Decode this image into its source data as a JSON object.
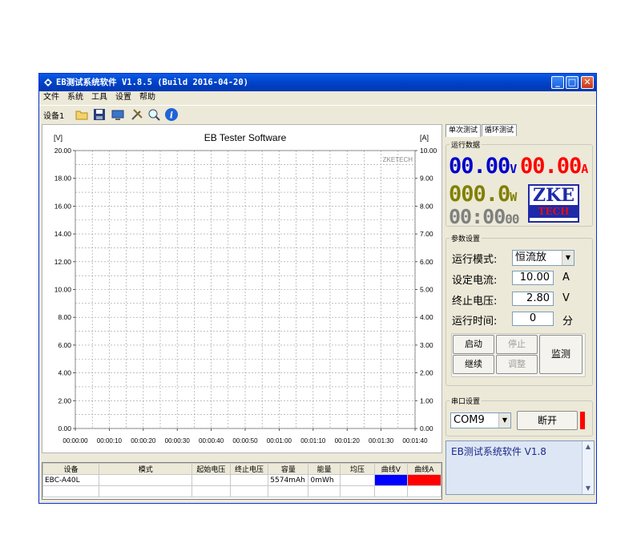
{
  "window": {
    "title": "EB测试系统软件 V1.8.5 (Build 2016-04-20)"
  },
  "menu": [
    "文件",
    "系统",
    "工具",
    "设置",
    "帮助"
  ],
  "toolbar": {
    "device_label": "设备1",
    "icons": [
      "folder-icon",
      "save-icon",
      "monitor-icon",
      "tools-icon",
      "search-icon",
      "info-icon"
    ]
  },
  "chart_data": {
    "type": "line",
    "title": "EB Tester Software",
    "watermark": "ZKETECH",
    "ylabel_left": "[V]",
    "ylabel_right": "[A]",
    "ylim_left": [
      0,
      20
    ],
    "ylim_right": [
      0,
      10
    ],
    "yticks_left": [
      "20.00",
      "18.00",
      "16.00",
      "14.00",
      "12.00",
      "10.00",
      "8.00",
      "6.00",
      "4.00",
      "2.00",
      "0.00"
    ],
    "yticks_right": [
      "10.00",
      "9.00",
      "8.00",
      "7.00",
      "6.00",
      "5.00",
      "4.00",
      "3.00",
      "2.00",
      "1.00",
      "0.00"
    ],
    "xticks": [
      "00:00:00",
      "00:00:10",
      "00:00:20",
      "00:00:30",
      "00:00:40",
      "00:00:50",
      "00:01:00",
      "00:01:10",
      "00:01:20",
      "00:01:30",
      "00:01:40"
    ],
    "grid": true,
    "series": []
  },
  "table": {
    "headers": [
      "设备",
      "模式",
      "起始电压",
      "终止电压",
      "容量",
      "能量",
      "均压",
      "曲线V",
      "曲线A"
    ],
    "rows": [
      [
        "EBC-A40L",
        "",
        "",
        "",
        "5574mAh",
        "0mWh",
        "",
        "",
        ""
      ],
      [
        "",
        "",
        "",
        "",
        "",
        "",
        "",
        "",
        ""
      ]
    ],
    "curve_v_color": "#0000ff",
    "curve_a_color": "#ff0000"
  },
  "tabs": [
    "单次测试",
    "循环测试"
  ],
  "run_data": {
    "title": "运行数据",
    "voltage": "00.00",
    "voltage_unit": "V",
    "current": "00.00",
    "current_unit": "A",
    "power": "000.0",
    "power_unit": "W",
    "time_hm": "00:00",
    "time_s": "00",
    "logo_top": "ZKE",
    "logo_bottom": "TECH",
    "voltage_color": "#0000cc",
    "current_color": "#ff0000",
    "power_color": "#808000",
    "time_color": "#808080"
  },
  "params": {
    "title": "参数设置",
    "mode_label": "运行模式:",
    "mode_value": "恒流放",
    "current_label": "设定电流:",
    "current_value": "10.00",
    "current_unit": "A",
    "cutoff_label": "终止电压:",
    "cutoff_value": "2.80",
    "cutoff_unit": "V",
    "time_label": "运行时间:",
    "time_value": "0",
    "time_unit": "分",
    "btn_start": "启动",
    "btn_stop": "停止",
    "btn_continue": "继续",
    "btn_adjust": "调整",
    "btn_monitor": "监测"
  },
  "serial": {
    "title": "串口设置",
    "port": "COM9",
    "btn_disconnect": "断开",
    "status_color": "#ff0000"
  },
  "info": {
    "text": "EB测试系统软件 V1.8"
  }
}
